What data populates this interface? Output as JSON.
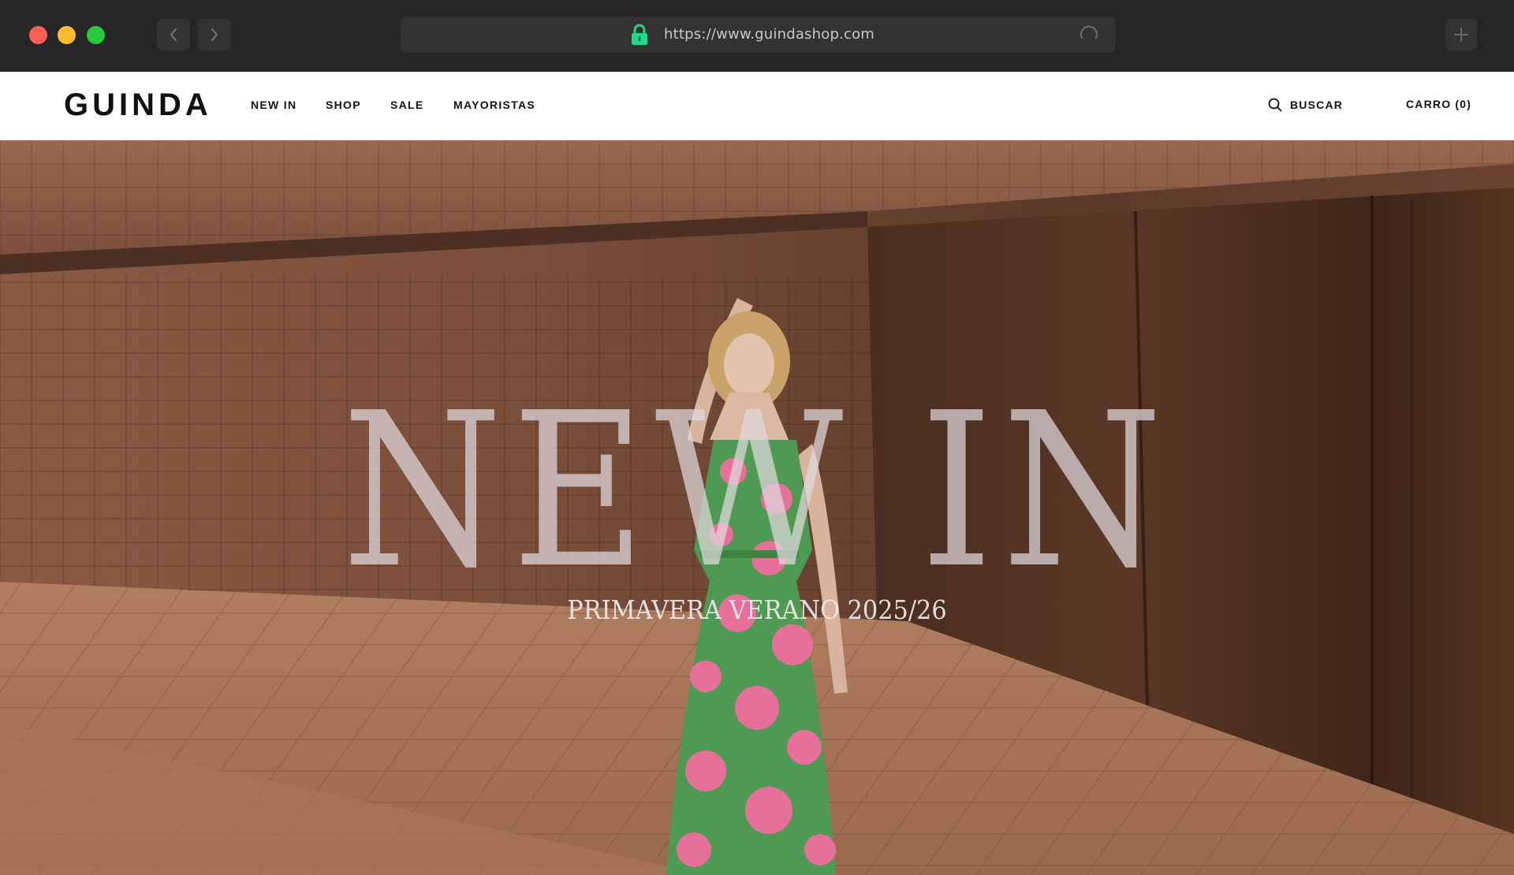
{
  "browser": {
    "url": "https://www.guindashop.com",
    "icons": {
      "back": "chevron-left-icon",
      "forward": "chevron-right-icon",
      "lock": "lock-icon",
      "reload": "reload-icon",
      "new_tab": "plus-icon"
    },
    "colors": {
      "lock": "#1ed98a",
      "close": "#ff5f57",
      "minimize": "#febc2e",
      "maximize": "#28c840"
    }
  },
  "header": {
    "logo": "GUINDA",
    "nav": [
      {
        "label": "NEW IN"
      },
      {
        "label": "SHOP"
      },
      {
        "label": "SALE"
      },
      {
        "label": "MAYORISTAS"
      }
    ],
    "search_label": "BUSCAR",
    "search_icon": "search-icon",
    "cart_label": "CARRO (0)"
  },
  "hero": {
    "title": "NEW IN",
    "subtitle": "PRIMAVERA VERANO 2025/26",
    "colors": {
      "dress_green": "#4f9a52",
      "dress_pink": "#e6709a"
    }
  }
}
